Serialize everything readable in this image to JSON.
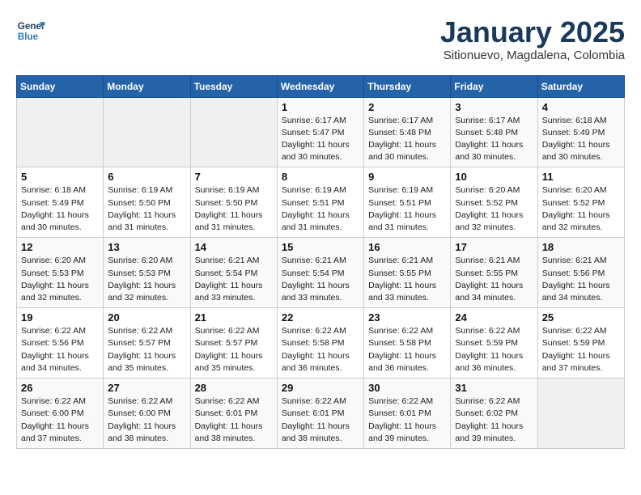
{
  "header": {
    "logo_line1": "General",
    "logo_line2": "Blue",
    "month": "January 2025",
    "location": "Sitionuevo, Magdalena, Colombia"
  },
  "days_of_week": [
    "Sunday",
    "Monday",
    "Tuesday",
    "Wednesday",
    "Thursday",
    "Friday",
    "Saturday"
  ],
  "weeks": [
    [
      {
        "day": "",
        "info": ""
      },
      {
        "day": "",
        "info": ""
      },
      {
        "day": "",
        "info": ""
      },
      {
        "day": "1",
        "info": "Sunrise: 6:17 AM\nSunset: 5:47 PM\nDaylight: 11 hours\nand 30 minutes."
      },
      {
        "day": "2",
        "info": "Sunrise: 6:17 AM\nSunset: 5:48 PM\nDaylight: 11 hours\nand 30 minutes."
      },
      {
        "day": "3",
        "info": "Sunrise: 6:17 AM\nSunset: 5:48 PM\nDaylight: 11 hours\nand 30 minutes."
      },
      {
        "day": "4",
        "info": "Sunrise: 6:18 AM\nSunset: 5:49 PM\nDaylight: 11 hours\nand 30 minutes."
      }
    ],
    [
      {
        "day": "5",
        "info": "Sunrise: 6:18 AM\nSunset: 5:49 PM\nDaylight: 11 hours\nand 30 minutes."
      },
      {
        "day": "6",
        "info": "Sunrise: 6:19 AM\nSunset: 5:50 PM\nDaylight: 11 hours\nand 31 minutes."
      },
      {
        "day": "7",
        "info": "Sunrise: 6:19 AM\nSunset: 5:50 PM\nDaylight: 11 hours\nand 31 minutes."
      },
      {
        "day": "8",
        "info": "Sunrise: 6:19 AM\nSunset: 5:51 PM\nDaylight: 11 hours\nand 31 minutes."
      },
      {
        "day": "9",
        "info": "Sunrise: 6:19 AM\nSunset: 5:51 PM\nDaylight: 11 hours\nand 31 minutes."
      },
      {
        "day": "10",
        "info": "Sunrise: 6:20 AM\nSunset: 5:52 PM\nDaylight: 11 hours\nand 32 minutes."
      },
      {
        "day": "11",
        "info": "Sunrise: 6:20 AM\nSunset: 5:52 PM\nDaylight: 11 hours\nand 32 minutes."
      }
    ],
    [
      {
        "day": "12",
        "info": "Sunrise: 6:20 AM\nSunset: 5:53 PM\nDaylight: 11 hours\nand 32 minutes."
      },
      {
        "day": "13",
        "info": "Sunrise: 6:20 AM\nSunset: 5:53 PM\nDaylight: 11 hours\nand 32 minutes."
      },
      {
        "day": "14",
        "info": "Sunrise: 6:21 AM\nSunset: 5:54 PM\nDaylight: 11 hours\nand 33 minutes."
      },
      {
        "day": "15",
        "info": "Sunrise: 6:21 AM\nSunset: 5:54 PM\nDaylight: 11 hours\nand 33 minutes."
      },
      {
        "day": "16",
        "info": "Sunrise: 6:21 AM\nSunset: 5:55 PM\nDaylight: 11 hours\nand 33 minutes."
      },
      {
        "day": "17",
        "info": "Sunrise: 6:21 AM\nSunset: 5:55 PM\nDaylight: 11 hours\nand 34 minutes."
      },
      {
        "day": "18",
        "info": "Sunrise: 6:21 AM\nSunset: 5:56 PM\nDaylight: 11 hours\nand 34 minutes."
      }
    ],
    [
      {
        "day": "19",
        "info": "Sunrise: 6:22 AM\nSunset: 5:56 PM\nDaylight: 11 hours\nand 34 minutes."
      },
      {
        "day": "20",
        "info": "Sunrise: 6:22 AM\nSunset: 5:57 PM\nDaylight: 11 hours\nand 35 minutes."
      },
      {
        "day": "21",
        "info": "Sunrise: 6:22 AM\nSunset: 5:57 PM\nDaylight: 11 hours\nand 35 minutes."
      },
      {
        "day": "22",
        "info": "Sunrise: 6:22 AM\nSunset: 5:58 PM\nDaylight: 11 hours\nand 36 minutes."
      },
      {
        "day": "23",
        "info": "Sunrise: 6:22 AM\nSunset: 5:58 PM\nDaylight: 11 hours\nand 36 minutes."
      },
      {
        "day": "24",
        "info": "Sunrise: 6:22 AM\nSunset: 5:59 PM\nDaylight: 11 hours\nand 36 minutes."
      },
      {
        "day": "25",
        "info": "Sunrise: 6:22 AM\nSunset: 5:59 PM\nDaylight: 11 hours\nand 37 minutes."
      }
    ],
    [
      {
        "day": "26",
        "info": "Sunrise: 6:22 AM\nSunset: 6:00 PM\nDaylight: 11 hours\nand 37 minutes."
      },
      {
        "day": "27",
        "info": "Sunrise: 6:22 AM\nSunset: 6:00 PM\nDaylight: 11 hours\nand 38 minutes."
      },
      {
        "day": "28",
        "info": "Sunrise: 6:22 AM\nSunset: 6:01 PM\nDaylight: 11 hours\nand 38 minutes."
      },
      {
        "day": "29",
        "info": "Sunrise: 6:22 AM\nSunset: 6:01 PM\nDaylight: 11 hours\nand 38 minutes."
      },
      {
        "day": "30",
        "info": "Sunrise: 6:22 AM\nSunset: 6:01 PM\nDaylight: 11 hours\nand 39 minutes."
      },
      {
        "day": "31",
        "info": "Sunrise: 6:22 AM\nSunset: 6:02 PM\nDaylight: 11 hours\nand 39 minutes."
      },
      {
        "day": "",
        "info": ""
      }
    ]
  ]
}
